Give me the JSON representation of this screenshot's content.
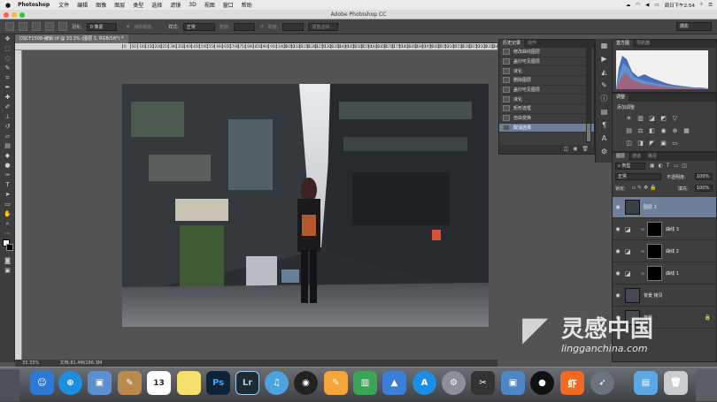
{
  "menubar": {
    "app": "Photoshop",
    "items": [
      "文件",
      "编辑",
      "图像",
      "图层",
      "类型",
      "选择",
      "滤镜",
      "3D",
      "视图",
      "窗口",
      "帮助"
    ],
    "clock": "周日下午2:54"
  },
  "window": {
    "title": "Adobe Photoshop CC"
  },
  "options": {
    "feather_label": "羽化:",
    "feather_value": "0 像素",
    "antialias_label": "消除锯齿",
    "style_label": "样式:",
    "style_value": "正常",
    "width_label": "宽度:",
    "height_label": "高度:",
    "refine_button": "调整边缘...",
    "workspace": "摄影"
  },
  "document": {
    "tab": "DSCF1508-编辑.tif @ 33.3% (图层 1, RGB/16*) *",
    "ruler_ticks": [
      "0",
      "50",
      "100",
      "150",
      "200",
      "250",
      "300",
      "350",
      "400",
      "450",
      "500",
      "550",
      "600",
      "650",
      "700",
      "750",
      "800",
      "850",
      "900",
      "950",
      "1000",
      "1050",
      "1100",
      "1150",
      "1200",
      "1250",
      "1300",
      "1350",
      "1400",
      "1450",
      "1500",
      "1550",
      "1600",
      "1650",
      "1700",
      "1750",
      "1800",
      "1850",
      "1900",
      "1950",
      "2000",
      "2050",
      "2100",
      "2150",
      "2200",
      "2250",
      "2300",
      "2350",
      "2400"
    ],
    "zoom": "33.33%",
    "doc_size": "文档:81.4M/286.3M"
  },
  "history": {
    "tabs": [
      "历史记录",
      "动作"
    ],
    "items": [
      "修改曲线图层",
      "盖印可见图层",
      "液化",
      "删除图层",
      "盖印可见图层",
      "液化",
      "矩形选框",
      "自由变换",
      "取消选择"
    ],
    "selected_index": 8
  },
  "histogram_panel": {
    "tabs": [
      "直方图",
      "导航器"
    ]
  },
  "adjustments": {
    "tab": "调整",
    "subtitle": "添加调整"
  },
  "layers_panel": {
    "tabs": [
      "图层",
      "通道",
      "路径"
    ],
    "kind_filter": "类型",
    "blend_mode": "正常",
    "opacity_label": "不透明度:",
    "opacity_value": "100%",
    "lock_label": "锁定:",
    "fill_label": "填充:",
    "fill_value": "100%",
    "layers": [
      {
        "name": "图层 1",
        "type": "pixel",
        "selected": true
      },
      {
        "name": "曲线 3",
        "type": "curves",
        "selected": false
      },
      {
        "name": "曲线 2",
        "type": "curves",
        "selected": false
      },
      {
        "name": "曲线 1",
        "type": "curves",
        "selected": false
      },
      {
        "name": "背景 拷贝",
        "type": "pixel",
        "selected": false
      },
      {
        "name": "背景",
        "type": "pixel",
        "selected": false
      }
    ]
  },
  "dock": {
    "icons": [
      "finder",
      "safari",
      "preview",
      "notes",
      "calendar",
      "stickies",
      "photoshop",
      "lightroom",
      "itunes",
      "dvd-player",
      "pages",
      "numbers",
      "keynote",
      "app-store",
      "system-preferences",
      "final-cut-pro",
      "iphoto",
      "qq",
      "xiami",
      "launchpad",
      "downloads",
      "trash"
    ],
    "calendar_day": "13",
    "ps_label": "Ps",
    "lr_label": "Lr",
    "xiami_label": "虾"
  },
  "watermark": {
    "cn": "灵感中国",
    "url": "lingganchina.com"
  },
  "colors": {
    "selection": "#6f7f99",
    "panel": "#3e3e3e",
    "workspace": "#535353"
  }
}
